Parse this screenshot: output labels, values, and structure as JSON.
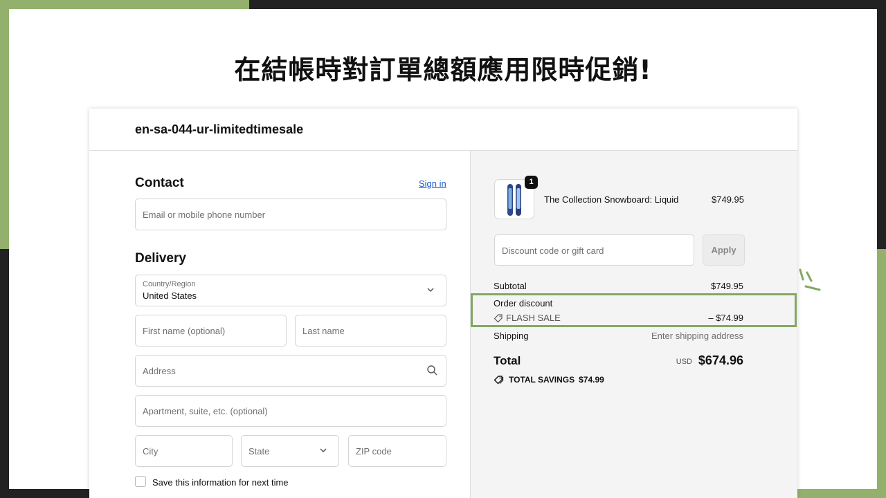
{
  "headline": "在結帳時對訂單總額應用限時促銷!",
  "store": {
    "name": "en-sa-044-ur-limitedtimesale"
  },
  "contact": {
    "title": "Contact",
    "sign_in": "Sign in",
    "email_placeholder": "Email or mobile phone number"
  },
  "delivery": {
    "title": "Delivery",
    "country_label": "Country/Region",
    "country_value": "United States",
    "first_name_placeholder": "First name (optional)",
    "last_name_placeholder": "Last name",
    "address_placeholder": "Address",
    "apartment_placeholder": "Apartment, suite, etc. (optional)",
    "city_placeholder": "City",
    "state_placeholder": "State",
    "zip_placeholder": "ZIP code",
    "save_info_label": "Save this information for next time"
  },
  "summary": {
    "product": {
      "name": "The Collection Snowboard: Liquid",
      "price": "$749.95",
      "quantity": "1"
    },
    "discount_placeholder": "Discount code or gift card",
    "apply_label": "Apply",
    "subtotal_label": "Subtotal",
    "subtotal_value": "$749.95",
    "order_discount_label": "Order discount",
    "discount_code": "FLASH SALE",
    "discount_value": "– $74.99",
    "shipping_label": "Shipping",
    "shipping_value": "Enter shipping address",
    "total_label": "Total",
    "currency": "USD",
    "total_value": "$674.96",
    "savings_label": "TOTAL SAVINGS",
    "savings_value": "$74.99"
  },
  "colors": {
    "accent_green": "#93b06c",
    "highlight_border": "#84a662",
    "link_blue": "#1a5bc9"
  }
}
